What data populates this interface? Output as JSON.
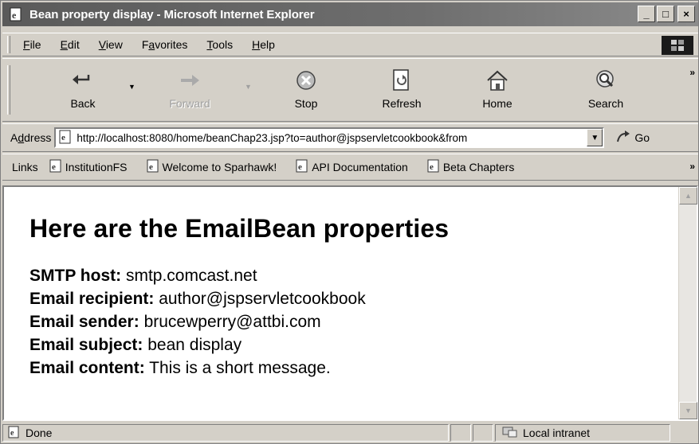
{
  "window": {
    "title": "Bean property display - Microsoft Internet Explorer",
    "controls": {
      "minimize": "_",
      "maximize": "□",
      "close": "×"
    }
  },
  "menu": {
    "items": [
      {
        "label": "File",
        "accel": "F",
        "rest": "ile"
      },
      {
        "label": "Edit",
        "accel": "E",
        "rest": "dit"
      },
      {
        "label": "View",
        "accel": "V",
        "rest": "iew"
      },
      {
        "label": "Favorites",
        "pre": "F",
        "accel": "a",
        "rest": "vorites"
      },
      {
        "label": "Tools",
        "accel": "T",
        "rest": "ools"
      },
      {
        "label": "Help",
        "accel": "H",
        "rest": "elp"
      }
    ]
  },
  "toolbar": {
    "back": "Back",
    "forward": "Forward",
    "stop": "Stop",
    "refresh": "Refresh",
    "home": "Home",
    "search": "Search",
    "more": "»"
  },
  "address": {
    "label_pre": "A",
    "label_accel": "d",
    "label_rest": "dress",
    "url": "http://localhost:8080/home/beanChap23.jsp?to=author@jspservletcookbook&from",
    "go": "Go"
  },
  "links": {
    "label": "Links",
    "items": [
      "InstitutionFS",
      "Welcome to Sparhawk!",
      "API Documentation",
      "Beta Chapters"
    ],
    "more": "»"
  },
  "page": {
    "heading": "Here are the EmailBean properties",
    "properties": [
      {
        "label": "SMTP host:",
        "value": "smtp.comcast.net"
      },
      {
        "label": "Email recipient:",
        "value": "author@jspservletcookbook"
      },
      {
        "label": "Email sender:",
        "value": "brucewperry@attbi.com"
      },
      {
        "label": "Email subject:",
        "value": "bean display"
      },
      {
        "label": "Email content:",
        "value": "This is a short message."
      }
    ]
  },
  "status": {
    "text": "Done",
    "zone": "Local intranet"
  }
}
